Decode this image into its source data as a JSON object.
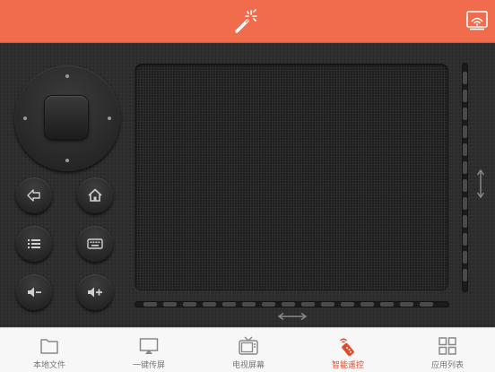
{
  "colors": {
    "accent": "#f06c4c",
    "active_tab": "#e24a2c",
    "background": "#2b2b2b",
    "tabbar_bg": "#f7f7f7"
  },
  "header": {
    "left_icon": "magic-wand-icon",
    "right_icon": "cast-screen-icon"
  },
  "remote": {
    "dpad_icon": "dpad-icon",
    "buttons": [
      {
        "id": "back",
        "icon": "back-arrow-icon"
      },
      {
        "id": "home",
        "icon": "home-icon"
      },
      {
        "id": "menu",
        "icon": "menu-list-icon"
      },
      {
        "id": "keyboard",
        "icon": "keyboard-icon"
      },
      {
        "id": "volume_down",
        "icon": "volume-down-icon"
      },
      {
        "id": "volume_up",
        "icon": "volume-up-icon"
      }
    ],
    "touchpad_icon": "touchpad-area"
  },
  "tabs": [
    {
      "label": "本地文件",
      "icon": "folder-icon",
      "active": false
    },
    {
      "label": "一键传屏",
      "icon": "screen-share-icon",
      "active": false
    },
    {
      "label": "电视屏幕",
      "icon": "tv-icon",
      "active": false
    },
    {
      "label": "智能遥控",
      "icon": "remote-control-icon",
      "active": true
    },
    {
      "label": "应用列表",
      "icon": "app-grid-icon",
      "active": false
    }
  ]
}
